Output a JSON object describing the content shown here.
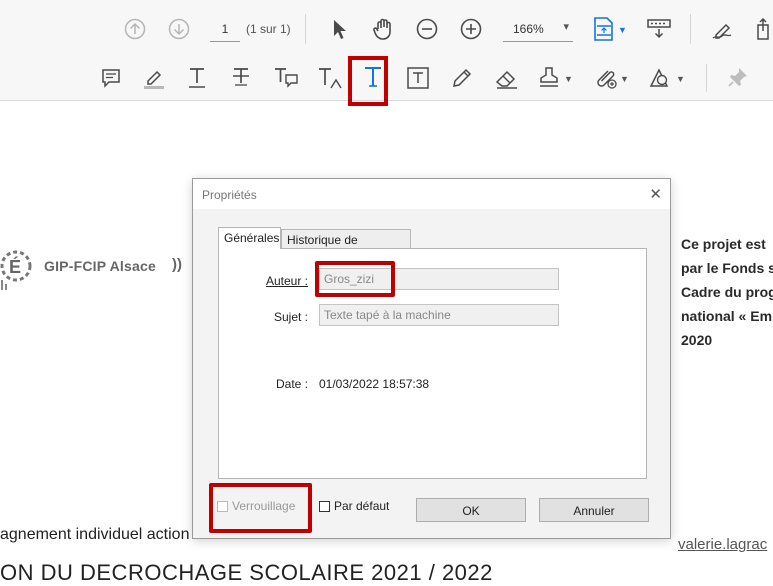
{
  "toolbar": {
    "page_current": "1",
    "page_total": "(1 sur 1)",
    "zoom": "166%"
  },
  "document": {
    "logo_text": "GIP-FCIP Alsace",
    "logo_paren": "))",
    "right_lines": [
      "Ce projet est",
      "par le Fonds s",
      "Cadre du prog",
      "national « Em",
      "2020"
    ],
    "bottom_line1": "agnement individuel action MLDS",
    "bottom_line2": "ON DU DECROCHAGE SCOLAIRE 2021 / 2022",
    "email": "valerie.lagrac"
  },
  "dialog": {
    "title": "Propriétés",
    "close_glyph": "✕",
    "tabs": [
      "Générales",
      "Historique de révisions"
    ],
    "author_label": "Auteur :",
    "author_value": "Gros_zizi",
    "subject_label": "Sujet :",
    "subject_value": "Texte tapé à la machine",
    "date_label": "Date :",
    "date_value": "01/03/2022 18:57:38",
    "lock_label": "Verrouillage",
    "default_label": "Par défaut",
    "ok_label": "OK",
    "cancel_label": "Annuler"
  },
  "colors": {
    "highlight": "#c00000",
    "accent": "#1473e6"
  }
}
